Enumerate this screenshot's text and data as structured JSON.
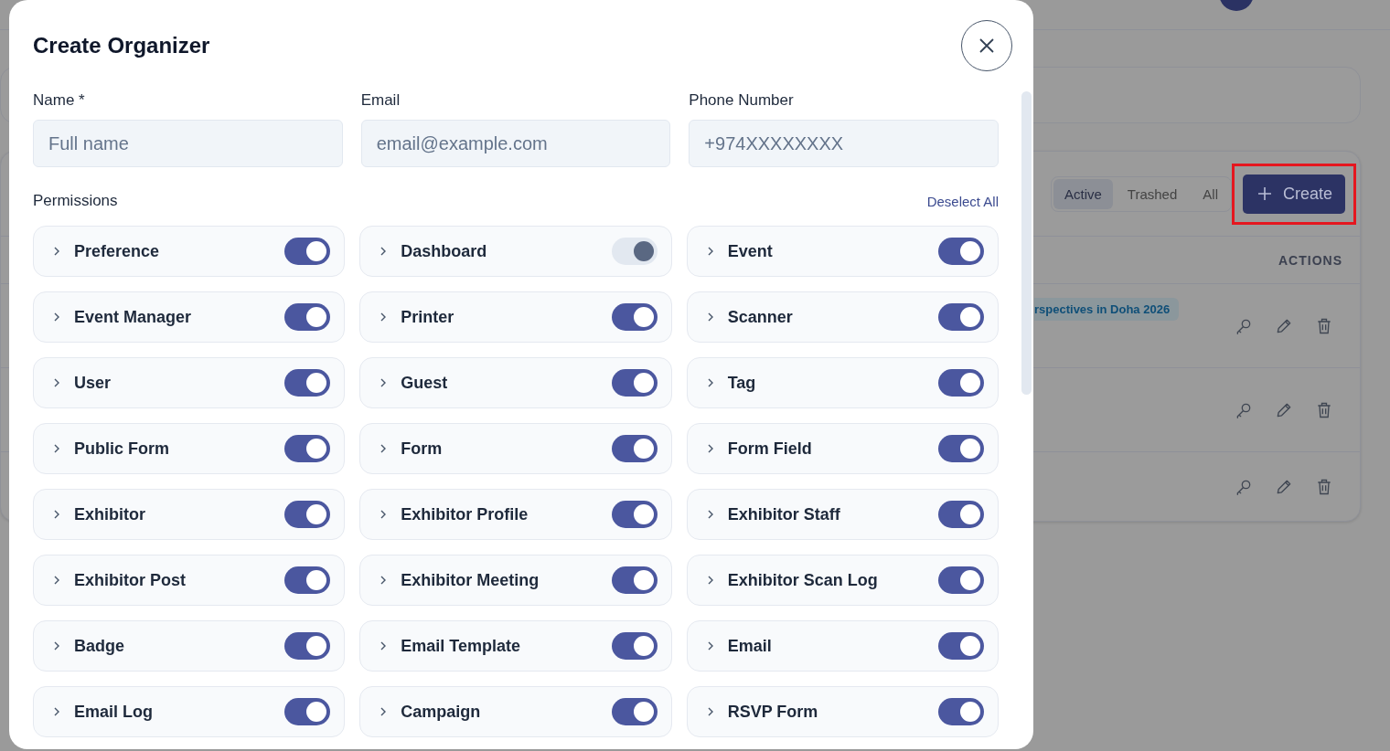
{
  "background_page": {
    "status_tabs": [
      {
        "label": "Active",
        "selected": true
      },
      {
        "label": "Trashed",
        "selected": false
      },
      {
        "label": "All",
        "selected": false
      }
    ],
    "create_button": {
      "label": "Create",
      "highlighted": true
    },
    "table": {
      "columns": [
        "ACTIONS"
      ],
      "rows": [
        {
          "badge": "rspectives in Doha 2026"
        },
        {},
        {}
      ]
    }
  },
  "modal": {
    "title": "Create Organizer",
    "fields": [
      {
        "label": "Name *",
        "placeholder": "Full name"
      },
      {
        "label": "Email",
        "placeholder": "email@example.com"
      },
      {
        "label": "Phone Number",
        "placeholder": "+974XXXXXXXX"
      }
    ],
    "permissions": {
      "label": "Permissions",
      "deselect_all": "Deselect All",
      "items": [
        {
          "name": "Preference",
          "on": true,
          "disabled": false
        },
        {
          "name": "Dashboard",
          "on": true,
          "disabled": true
        },
        {
          "name": "Event",
          "on": true,
          "disabled": false
        },
        {
          "name": "Event Manager",
          "on": true,
          "disabled": false
        },
        {
          "name": "Printer",
          "on": true,
          "disabled": false
        },
        {
          "name": "Scanner",
          "on": true,
          "disabled": false
        },
        {
          "name": "User",
          "on": true,
          "disabled": false
        },
        {
          "name": "Guest",
          "on": true,
          "disabled": false
        },
        {
          "name": "Tag",
          "on": true,
          "disabled": false
        },
        {
          "name": "Public Form",
          "on": true,
          "disabled": false
        },
        {
          "name": "Form",
          "on": true,
          "disabled": false
        },
        {
          "name": "Form Field",
          "on": true,
          "disabled": false
        },
        {
          "name": "Exhibitor",
          "on": true,
          "disabled": false
        },
        {
          "name": "Exhibitor Profile",
          "on": true,
          "disabled": false
        },
        {
          "name": "Exhibitor Staff",
          "on": true,
          "disabled": false
        },
        {
          "name": "Exhibitor Post",
          "on": true,
          "disabled": false
        },
        {
          "name": "Exhibitor Meeting",
          "on": true,
          "disabled": false
        },
        {
          "name": "Exhibitor Scan Log",
          "on": true,
          "disabled": false
        },
        {
          "name": "Badge",
          "on": true,
          "disabled": false
        },
        {
          "name": "Email Template",
          "on": true,
          "disabled": false
        },
        {
          "name": "Email",
          "on": true,
          "disabled": false
        },
        {
          "name": "Email Log",
          "on": true,
          "disabled": false
        },
        {
          "name": "Campaign",
          "on": true,
          "disabled": false
        },
        {
          "name": "RSVP Form",
          "on": true,
          "disabled": false
        }
      ]
    }
  }
}
